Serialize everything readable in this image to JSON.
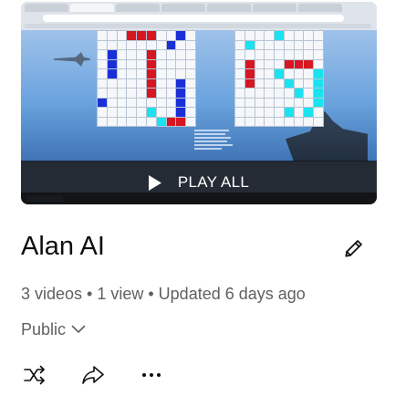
{
  "playlist": {
    "play_all_label": "PLAY ALL",
    "title": "Alan AI",
    "meta": "3 videos • 1 view • Updated 6 days ago",
    "privacy": "Public"
  },
  "icons": {
    "play": "play-icon",
    "edit": "pencil-icon",
    "privacy_dropdown": "chevron-down-icon",
    "shuffle": "shuffle-icon",
    "share": "share-icon",
    "more": "more-horizontal-icon"
  },
  "colors": {
    "title_text": "#0f0f0f",
    "secondary_text": "#606060",
    "play_bar": "#0f0f0f",
    "grid_blue": "#1a2fd6",
    "grid_red": "#d61620",
    "grid_cyan": "#19e3ee"
  },
  "thumbnail": {
    "left_grid": {
      "cols": 10,
      "rows": 10,
      "filled": [
        {
          "r": 0,
          "c": 3,
          "color": "red"
        },
        {
          "r": 0,
          "c": 4,
          "color": "red"
        },
        {
          "r": 0,
          "c": 5,
          "color": "red"
        },
        {
          "r": 0,
          "c": 8,
          "color": "blue"
        },
        {
          "r": 1,
          "c": 7,
          "color": "blue"
        },
        {
          "r": 2,
          "c": 1,
          "color": "blue"
        },
        {
          "r": 2,
          "c": 5,
          "color": "red"
        },
        {
          "r": 3,
          "c": 1,
          "color": "blue"
        },
        {
          "r": 3,
          "c": 5,
          "color": "red"
        },
        {
          "r": 4,
          "c": 1,
          "color": "blue"
        },
        {
          "r": 4,
          "c": 5,
          "color": "red"
        },
        {
          "r": 5,
          "c": 5,
          "color": "red"
        },
        {
          "r": 5,
          "c": 8,
          "color": "blue"
        },
        {
          "r": 6,
          "c": 5,
          "color": "red"
        },
        {
          "r": 6,
          "c": 8,
          "color": "blue"
        },
        {
          "r": 7,
          "c": 0,
          "color": "blue"
        },
        {
          "r": 7,
          "c": 8,
          "color": "blue"
        },
        {
          "r": 8,
          "c": 5,
          "color": "cyan"
        },
        {
          "r": 8,
          "c": 8,
          "color": "blue"
        },
        {
          "r": 9,
          "c": 6,
          "color": "cyan"
        },
        {
          "r": 9,
          "c": 7,
          "color": "red"
        },
        {
          "r": 9,
          "c": 8,
          "color": "red"
        }
      ]
    },
    "right_grid": {
      "cols": 9,
      "rows": 10,
      "filled": [
        {
          "r": 0,
          "c": 4,
          "color": "cyan"
        },
        {
          "r": 1,
          "c": 1,
          "color": "cyan"
        },
        {
          "r": 3,
          "c": 1,
          "color": "red"
        },
        {
          "r": 3,
          "c": 5,
          "color": "red"
        },
        {
          "r": 3,
          "c": 6,
          "color": "red"
        },
        {
          "r": 3,
          "c": 7,
          "color": "red"
        },
        {
          "r": 4,
          "c": 1,
          "color": "red"
        },
        {
          "r": 4,
          "c": 4,
          "color": "cyan"
        },
        {
          "r": 4,
          "c": 8,
          "color": "cyan"
        },
        {
          "r": 5,
          "c": 1,
          "color": "red"
        },
        {
          "r": 5,
          "c": 5,
          "color": "cyan"
        },
        {
          "r": 5,
          "c": 8,
          "color": "cyan"
        },
        {
          "r": 6,
          "c": 6,
          "color": "cyan"
        },
        {
          "r": 6,
          "c": 8,
          "color": "cyan"
        },
        {
          "r": 7,
          "c": 8,
          "color": "cyan"
        },
        {
          "r": 8,
          "c": 5,
          "color": "cyan"
        },
        {
          "r": 8,
          "c": 7,
          "color": "cyan"
        }
      ]
    }
  }
}
